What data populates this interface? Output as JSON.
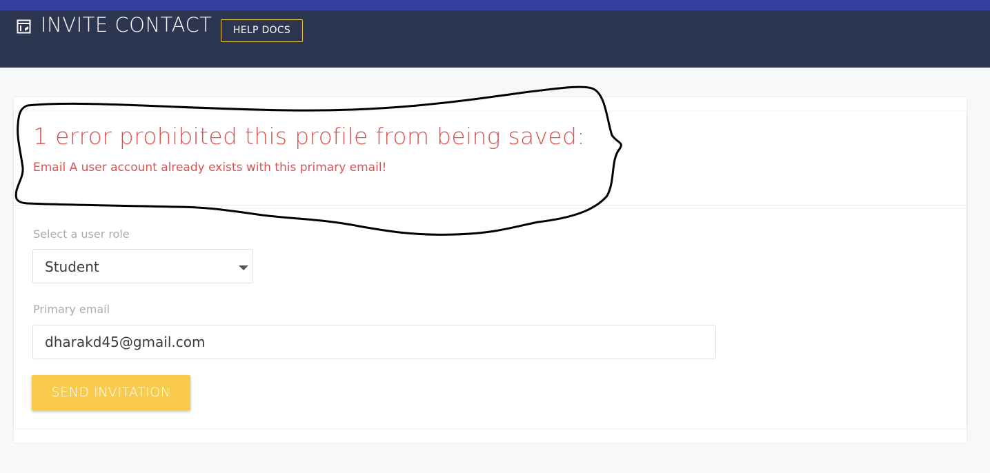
{
  "header": {
    "icon": "document-edit-icon",
    "title": "INVITE CONTACT",
    "help_label": "HELP DOCS"
  },
  "error": {
    "title": "1 error prohibited this profile from being saved:",
    "message": "Email A user account already exists with this primary email!"
  },
  "form": {
    "role_label": "Select a user role",
    "role_value": "Student",
    "email_label": "Primary email",
    "email_value": "dharakd45@gmail.com",
    "submit_label": "SEND INVITATION"
  },
  "colors": {
    "header_bg": "#2c3650",
    "accent_bar": "#323ea0",
    "error": "#d9534f",
    "button": "#f9cb4d",
    "help_border": "#f2c43a"
  }
}
